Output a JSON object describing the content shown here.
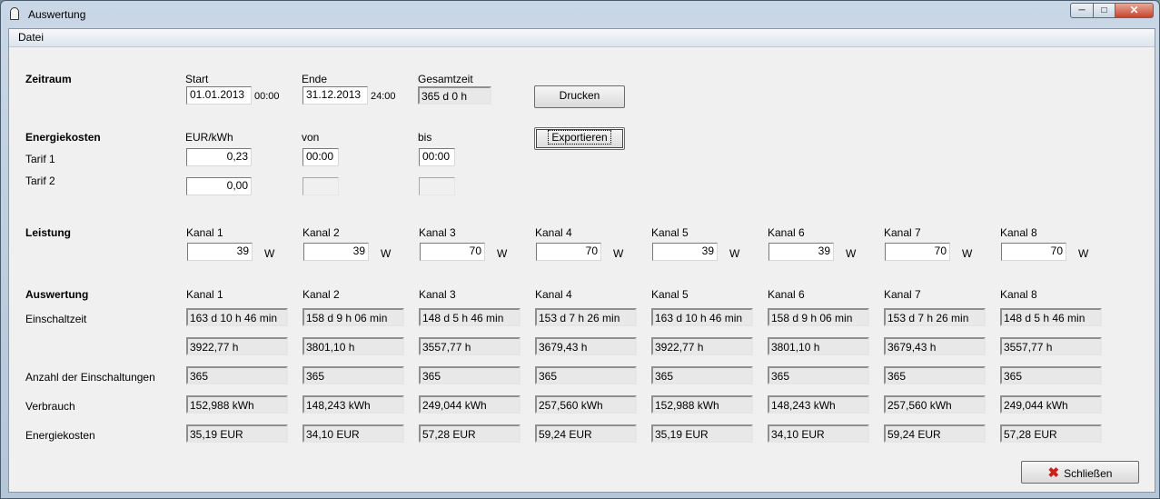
{
  "window": {
    "title": "Auswertung"
  },
  "menu": {
    "file": "Datei"
  },
  "zeitraum": {
    "label": "Zeitraum",
    "start_label": "Start",
    "start_date": "01.01.2013",
    "start_time": "00:00",
    "end_label": "Ende",
    "end_date": "31.12.2013",
    "end_time": "24:00",
    "total_label": "Gesamtzeit",
    "total_value": "365 d  0 h"
  },
  "buttons": {
    "print": "Drucken",
    "export": "Exportieren",
    "close": "Schließen"
  },
  "energiekosten": {
    "label": "Energiekosten",
    "col_price": "EUR/kWh",
    "col_from": "von",
    "col_to": "bis",
    "tarif1_label": "Tarif 1",
    "tarif1_price": "0,23",
    "tarif1_from": "00:00",
    "tarif1_to": "00:00",
    "tarif2_label": "Tarif 2",
    "tarif2_price": "0,00"
  },
  "leistung": {
    "label": "Leistung",
    "unit": "W",
    "channels": [
      {
        "name": "Kanal  1",
        "value": "39"
      },
      {
        "name": "Kanal  2",
        "value": "39"
      },
      {
        "name": "Kanal  3",
        "value": "70"
      },
      {
        "name": "Kanal  4",
        "value": "70"
      },
      {
        "name": "Kanal  5",
        "value": "39"
      },
      {
        "name": "Kanal  6",
        "value": "39"
      },
      {
        "name": "Kanal  7",
        "value": "70"
      },
      {
        "name": "Kanal  8",
        "value": "70"
      }
    ]
  },
  "auswertung": {
    "label": "Auswertung",
    "rows": {
      "einschaltzeit": "Einschaltzeit",
      "anzahl": "Anzahl der Einschaltungen",
      "verbrauch": "Verbrauch",
      "energiekosten": "Energiekosten"
    },
    "channels": [
      {
        "name": "Kanal  1",
        "ontime": "163 d  10 h  46 min",
        "hours": "3922,77 h",
        "count": "365",
        "consumption": "152,988 kWh",
        "cost": "35,19 EUR"
      },
      {
        "name": "Kanal  2",
        "ontime": "158 d  9 h  06 min",
        "hours": "3801,10 h",
        "count": "365",
        "consumption": "148,243 kWh",
        "cost": "34,10 EUR"
      },
      {
        "name": "Kanal  3",
        "ontime": "148 d  5 h  46 min",
        "hours": "3557,77 h",
        "count": "365",
        "consumption": "249,044 kWh",
        "cost": "57,28 EUR"
      },
      {
        "name": "Kanal  4",
        "ontime": "153 d  7 h  26 min",
        "hours": "3679,43 h",
        "count": "365",
        "consumption": "257,560 kWh",
        "cost": "59,24 EUR"
      },
      {
        "name": "Kanal  5",
        "ontime": "163 d  10 h  46 min",
        "hours": "3922,77 h",
        "count": "365",
        "consumption": "152,988 kWh",
        "cost": "35,19 EUR"
      },
      {
        "name": "Kanal  6",
        "ontime": "158 d  9 h  06 min",
        "hours": "3801,10 h",
        "count": "365",
        "consumption": "148,243 kWh",
        "cost": "34,10 EUR"
      },
      {
        "name": "Kanal  7",
        "ontime": "153 d  7 h  26 min",
        "hours": "3679,43 h",
        "count": "365",
        "consumption": "257,560 kWh",
        "cost": "59,24 EUR"
      },
      {
        "name": "Kanal  8",
        "ontime": "148 d  5 h  46 min",
        "hours": "3557,77 h",
        "count": "365",
        "consumption": "249,044 kWh",
        "cost": "57,28 EUR"
      }
    ]
  }
}
